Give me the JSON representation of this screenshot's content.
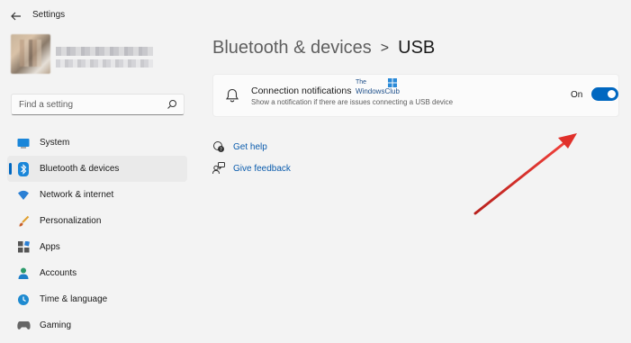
{
  "window": {
    "title": "Settings"
  },
  "search": {
    "placeholder": "Find a setting"
  },
  "sidebar": {
    "items": [
      {
        "label": "System",
        "icon": "system-icon"
      },
      {
        "label": "Bluetooth & devices",
        "icon": "bluetooth-icon",
        "active": true
      },
      {
        "label": "Network & internet",
        "icon": "network-icon"
      },
      {
        "label": "Personalization",
        "icon": "personalization-icon"
      },
      {
        "label": "Apps",
        "icon": "apps-icon"
      },
      {
        "label": "Accounts",
        "icon": "accounts-icon"
      },
      {
        "label": "Time & language",
        "icon": "time-language-icon"
      },
      {
        "label": "Gaming",
        "icon": "gaming-icon"
      }
    ]
  },
  "breadcrumb": {
    "parent": "Bluetooth & devices",
    "separator": ">",
    "current": "USB"
  },
  "setting": {
    "title": "Connection notifications",
    "description": "Show a notification if there are issues connecting a USB device",
    "toggle_label": "On",
    "toggle_state": true
  },
  "watermark": {
    "line1": "The",
    "line2": "WindowsClub"
  },
  "links": {
    "help": "Get help",
    "feedback": "Give feedback"
  },
  "colors": {
    "accent": "#0067c0",
    "link": "#0b5cad",
    "arrow": "#e0302a"
  }
}
